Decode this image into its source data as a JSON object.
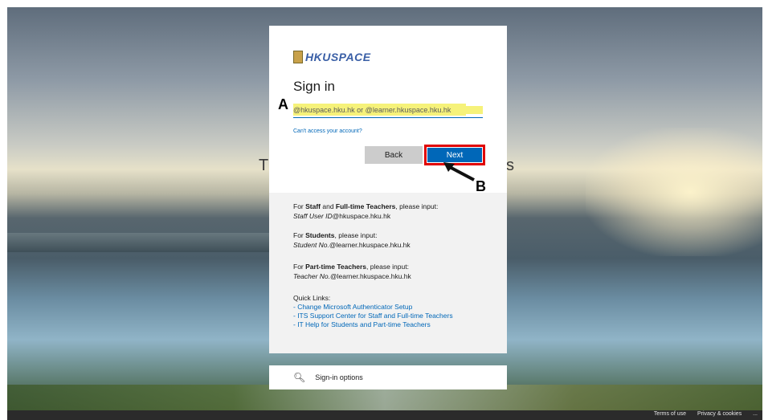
{
  "background": {
    "left_letter": "T",
    "right_letter": "s"
  },
  "card": {
    "logo_text": "HKUSPACE",
    "title": "Sign in",
    "email_placeholder": "@hkuspace.hku.hk or @learner.hkuspace.hku.hk",
    "cant_access": "Can't access your account?",
    "back_label": "Back",
    "next_label": "Next"
  },
  "annotations": {
    "label_a": "A",
    "label_b": "B"
  },
  "info": {
    "staff_pre": "For ",
    "staff_bold": "Staff",
    "staff_mid": " and ",
    "staff_bold2": "Full-time Teachers",
    "staff_post": ", please input:",
    "staff_format_italic": "Staff User ID",
    "staff_format_rest": "@hkuspace.hku.hk",
    "students_pre": "For ",
    "students_bold": "Students",
    "students_post": ", please input:",
    "students_format_italic": "Student No.",
    "students_format_rest": "@learner.hkuspace.hku.hk",
    "pt_pre": "For ",
    "pt_bold": "Part-time Teachers",
    "pt_post": ", please input:",
    "pt_format_italic": "Teacher No.",
    "pt_format_rest": "@learner.hkuspace.hku.hk"
  },
  "quick_links": {
    "title": "Quick Links:",
    "items": [
      "- Change Microsoft Authenticator Setup",
      "- ITS Support Center for Staff and Full-time Teachers",
      "- IT Help for Students and Part-time Teachers"
    ]
  },
  "signin_options": {
    "label": "Sign-in options",
    "icon": "key-icon"
  },
  "footer": {
    "terms": "Terms of use",
    "privacy": "Privacy & cookies",
    "more": "..."
  },
  "colors": {
    "accent": "#0067b8",
    "highlight": "#f6f27a",
    "annotation_red": "#e00000"
  }
}
